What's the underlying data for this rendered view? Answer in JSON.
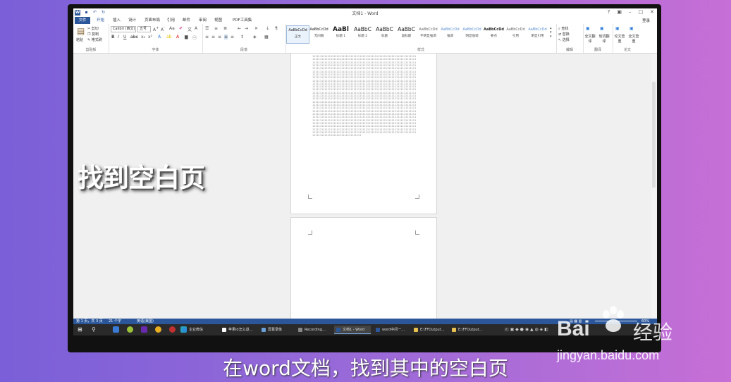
{
  "window": {
    "title": "文档1 - Word",
    "controls": [
      "?",
      "▣",
      "–",
      "□",
      "✕"
    ],
    "login": "登录"
  },
  "qat": {
    "icons": [
      "save-icon",
      "undo-icon",
      "redo-icon"
    ]
  },
  "tabs": {
    "file": "文件",
    "items": [
      "开始",
      "插入",
      "设计",
      "页面布局",
      "引用",
      "邮件",
      "审阅",
      "视图",
      "PDF工具集"
    ]
  },
  "ribbon": {
    "clipboard": {
      "label": "剪贴板",
      "paste": "粘贴",
      "cut": "剪切",
      "copy": "复制",
      "format_painter": "格式刷"
    },
    "font": {
      "label": "字体",
      "name": "Calibri (西文)",
      "size": "五号",
      "bold": "B",
      "italic": "I",
      "underline": "U",
      "strike": "abc"
    },
    "paragraph": {
      "label": "段落"
    },
    "styles": {
      "label": "样式",
      "items": [
        {
          "preview": "AaBbCcDd",
          "name": "正文"
        },
        {
          "preview": "AaBbCcDd",
          "name": "无间隔"
        },
        {
          "preview": "AaBl",
          "name": "标题 1"
        },
        {
          "preview": "AaBbC",
          "name": "标题 2"
        },
        {
          "preview": "AaBbC",
          "name": "标题"
        },
        {
          "preview": "AaBbC",
          "name": "副标题"
        },
        {
          "preview": "AaBbCcDd",
          "name": "不明显强调"
        },
        {
          "preview": "AaBbCcDd",
          "name": "强调"
        },
        {
          "preview": "AaBbCcDd",
          "name": "明显强调"
        },
        {
          "preview": "AaBbCcDd",
          "name": "要点"
        },
        {
          "preview": "AaBbCcDd",
          "name": "引用"
        },
        {
          "preview": "AaBbCcDd",
          "name": "明显引用"
        }
      ]
    },
    "editing": {
      "label": "编辑",
      "find": "查找",
      "replace": "替换",
      "select": "选择"
    },
    "translate": {
      "label": "翻译",
      "full": "全文翻译",
      "choose": "划词翻译"
    },
    "paper": {
      "label": "论文",
      "check": "论文查重",
      "full": "全文查重"
    }
  },
  "document": {
    "filler_char": "1"
  },
  "statusbar": {
    "page": "第 1 页，共 3 页",
    "words": "21 个字",
    "lang": "英语(美国)",
    "zoom": "60%"
  },
  "taskbar": {
    "items": [
      "企业微信",
      "苹果id怎么退…",
      "屏幕录像",
      "Recording…",
      "文档1 - Word",
      "word中间一…",
      "E:\\FFOutput…",
      "E:\\FFOutput…"
    ]
  },
  "captions": {
    "overlay": "找到空白页",
    "subtitle": "在word文档，找到其中的空白页"
  },
  "watermark": {
    "brand": "Bai",
    "brand_cn": "经验",
    "url": "jingyan.baidu.com"
  },
  "colors": {
    "word_blue": "#2b579a"
  }
}
